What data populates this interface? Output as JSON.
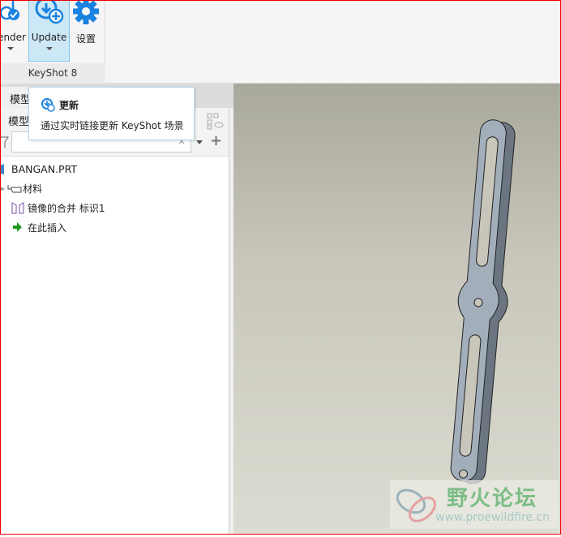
{
  "ribbon": {
    "buttons": [
      {
        "label": "Render"
      },
      {
        "label": "Update"
      },
      {
        "label": "设置"
      }
    ],
    "group_label": "KeyShot 8"
  },
  "tooltip": {
    "title": "更新",
    "description": "通过实时链接更新 KeyShot 场景"
  },
  "left_panel": {
    "tab_label": "模型树",
    "subheader_label": "模型树",
    "search": {
      "value": "",
      "placeholder": ""
    },
    "tree": [
      {
        "label": "BANGAN.PRT",
        "icon": "part-icon"
      },
      {
        "label": "材料",
        "icon": "material-tag-icon"
      },
      {
        "label": "镜像的合并 标识1",
        "icon": "mirror-merge-icon"
      },
      {
        "label": "在此插入",
        "icon": "insert-here-arrow-icon"
      }
    ]
  },
  "watermark": {
    "title": "野火论坛",
    "url": "www.proewildfire.cn"
  },
  "colors": {
    "accent": "#1a82e0",
    "selected_bg": "#cce8f6",
    "insert_green": "#1e9a1e"
  }
}
